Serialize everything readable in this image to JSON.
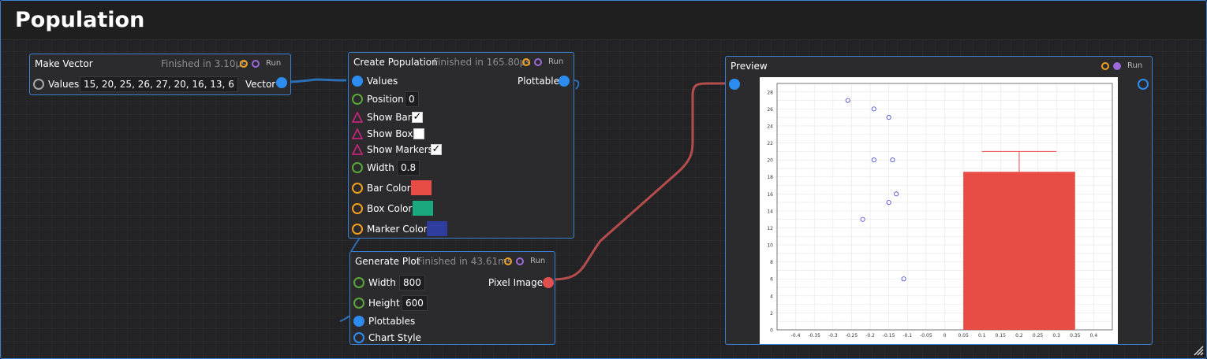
{
  "window": {
    "title": "Population"
  },
  "icons": {
    "resize": "resize-grip-icon",
    "status": "status-ring-icon",
    "checkbox": "check-icon"
  },
  "nodes": {
    "make_vector": {
      "name": "Make Vector",
      "status": "Finished in 3.10µs",
      "run_label": "Run",
      "input_label": "Values",
      "input_value": "15, 20, 25, 26, 27, 20, 16, 13, 6",
      "output_label": "Vector"
    },
    "create_population": {
      "name": "Create Population",
      "status": "Finished in 165.80µs",
      "run_label": "Run",
      "values_label": "Values",
      "output_label": "Plottable",
      "position_label": "Position",
      "position_value": "0",
      "show_bar_label": "Show Bar",
      "show_bar": true,
      "show_box_label": "Show Box",
      "show_box": false,
      "show_markers_label": "Show Markers",
      "show_markers": true,
      "width_label": "Width",
      "width_value": "0.8",
      "bar_color_label": "Bar Color",
      "bar_color": "#e84c45",
      "box_color_label": "Box Color",
      "box_color": "#1aa97f",
      "marker_color_label": "Marker Color",
      "marker_color": "#2f3e9e"
    },
    "generate_plot": {
      "name": "Generate Plot",
      "status": "Finished in 43.61ms",
      "run_label": "Run",
      "width_label": "Width",
      "width_value": "800",
      "height_label": "Height",
      "height_value": "600",
      "plottables_label": "Plottables",
      "chart_style_label": "Chart Style",
      "output_label": "Pixel Image"
    },
    "preview": {
      "name": "Preview",
      "run_label": "Run"
    }
  },
  "colors": {
    "accent": "#3b82d6",
    "pin_blue": "#2d8cf0",
    "wire_blue": "#2d6fb5",
    "wire_red": "#b54d4d"
  },
  "chart_data": {
    "type": "bar",
    "title": "",
    "xlabel": "",
    "ylabel": "",
    "xlim": [
      -0.45,
      0.45
    ],
    "ylim": [
      0,
      29
    ],
    "x_ticks": [
      "-0.4",
      "-0.35",
      "-0.3",
      "-0.25",
      "-0.2",
      "-0.15",
      "-0.1",
      "-0.05",
      "0",
      "0.05",
      "0.1",
      "0.15",
      "0.2",
      "0.25",
      "0.3",
      "0.35",
      "0.4"
    ],
    "y_ticks": [
      "0",
      "2",
      "4",
      "6",
      "8",
      "10",
      "12",
      "14",
      "16",
      "18",
      "20",
      "22",
      "24",
      "26",
      "28"
    ],
    "bar": {
      "x_from": 0.05,
      "x_to": 0.35,
      "value": 18.6,
      "error_top": 21,
      "color": "#e84c45"
    },
    "markers": {
      "x": [
        -0.15,
        -0.19,
        -0.15,
        -0.19,
        -0.26,
        -0.14,
        -0.13,
        -0.22,
        -0.11
      ],
      "y": [
        15,
        20,
        25,
        26,
        27,
        20,
        16,
        13,
        6
      ],
      "color": "#3b3bd0"
    },
    "grid": true,
    "legend": "none"
  }
}
